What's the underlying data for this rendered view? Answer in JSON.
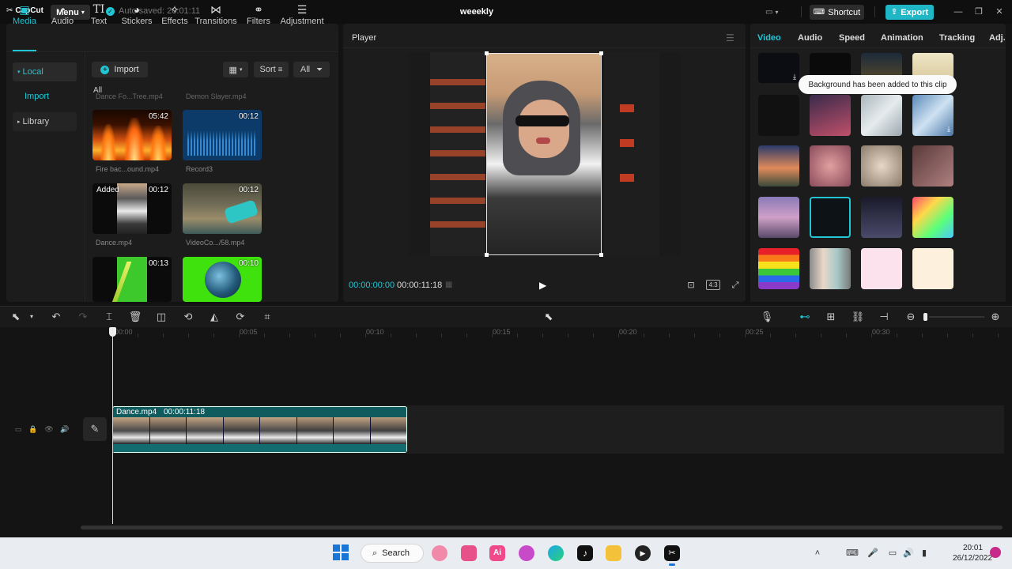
{
  "titlebar": {
    "logo": "CapCut",
    "menu_label": "Menu",
    "autosave": "Auto saved: 20:01:11",
    "project_title": "weeekly",
    "shortcut_label": "Shortcut",
    "export_label": "Export"
  },
  "media_tabs": [
    {
      "label": "Media",
      "icon": "media-icon"
    },
    {
      "label": "Audio",
      "icon": "audio-icon"
    },
    {
      "label": "Text",
      "icon": "text-icon"
    },
    {
      "label": "Stickers",
      "icon": "stickers-icon"
    },
    {
      "label": "Effects",
      "icon": "effects-icon"
    },
    {
      "label": "Transitions",
      "icon": "transitions-icon"
    },
    {
      "label": "Filters",
      "icon": "filters-icon"
    },
    {
      "label": "Adjustment",
      "icon": "adjustment-icon"
    }
  ],
  "sidebar": {
    "local": "Local",
    "import": "Import",
    "library": "Library"
  },
  "media_toolbar": {
    "import_label": "Import",
    "sort_label": "Sort",
    "all_label": "All"
  },
  "media_section": "All",
  "media_items": [
    {
      "name": "Fire bac...ound.mp4",
      "duration": "05:42",
      "added": ""
    },
    {
      "name": "Record3",
      "duration": "00:12",
      "added": ""
    },
    {
      "name": "Dance.mp4",
      "duration": "00:12",
      "added": "Added"
    },
    {
      "name": "VideoCo.../58.mp4",
      "duration": "00:12",
      "added": ""
    },
    {
      "name": "",
      "duration": "00:13",
      "added": ""
    },
    {
      "name": "",
      "duration": "00:10",
      "added": ""
    }
  ],
  "media_cut_names": [
    "Dance Fo...Tree.mp4",
    "Demon Slayer.mp4"
  ],
  "player": {
    "title": "Player",
    "current_time": "00:00:00:00",
    "total_time": "00:00:11:18",
    "ratio": "4:3"
  },
  "right_tabs": [
    "Video",
    "Audio",
    "Speed",
    "Animation",
    "Tracking",
    "Adj."
  ],
  "tooltip": "Background has been added to this clip",
  "timeline": {
    "ticks": [
      "00:00",
      "00:05",
      "00:10",
      "00:15",
      "00:20",
      "00:25",
      "00:30"
    ],
    "clip_name": "Dance.mp4",
    "clip_duration": "00:00:11:18"
  },
  "taskbar": {
    "search_label": "Search",
    "time": "20:01",
    "date": "26/12/2022"
  },
  "colors": {
    "accent": "#22c5d3",
    "panel": "#1c1c1d",
    "clip": "#0f5b5e"
  }
}
